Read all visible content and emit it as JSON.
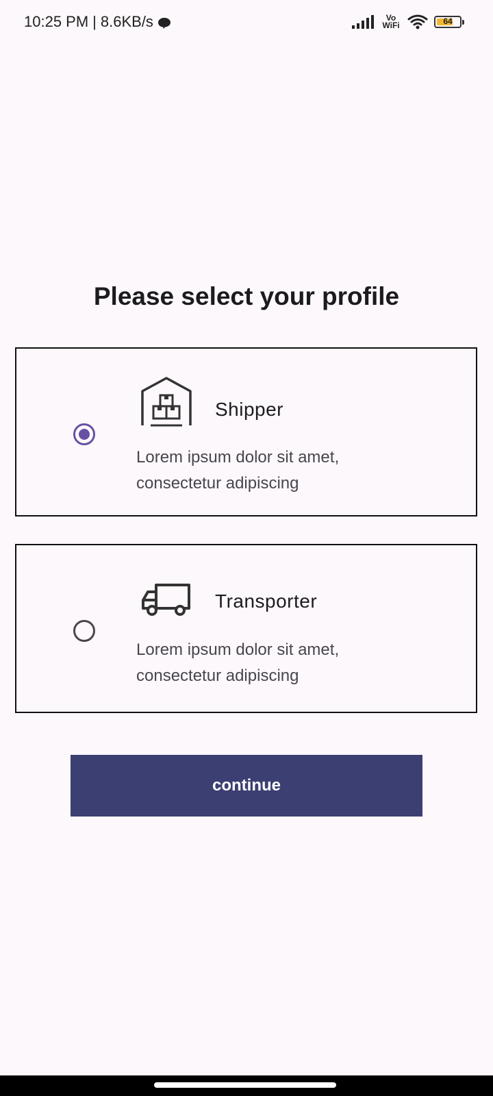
{
  "status_bar": {
    "time": "10:25 PM",
    "separator": "|",
    "network_speed": "8.6KB/s",
    "vowifi_top": "Vo",
    "vowifi_bottom": "WiFi",
    "battery_level": "64",
    "battery_fraction": 0.64,
    "battery_color": "#f2b732",
    "icons": [
      "chat-icon",
      "signal-icon",
      "vowifi-icon",
      "wifi-icon",
      "battery-icon"
    ]
  },
  "page": {
    "title": "Please select your profile"
  },
  "profiles": [
    {
      "id": "shipper",
      "label": "Shipper",
      "description": "Lorem ipsum dolor sit amet, consectetur adipiscing",
      "icon": "warehouse-icon",
      "selected": true
    },
    {
      "id": "transporter",
      "label": "Transporter",
      "description": "Lorem ipsum dolor sit amet, consectetur adipiscing",
      "icon": "truck-icon",
      "selected": false
    }
  ],
  "actions": {
    "continue_label": "continue"
  },
  "colors": {
    "background": "#fdf8fb",
    "accent_radio": "#6750a4",
    "button": "#3b3f72",
    "button_text": "#ffffff"
  }
}
